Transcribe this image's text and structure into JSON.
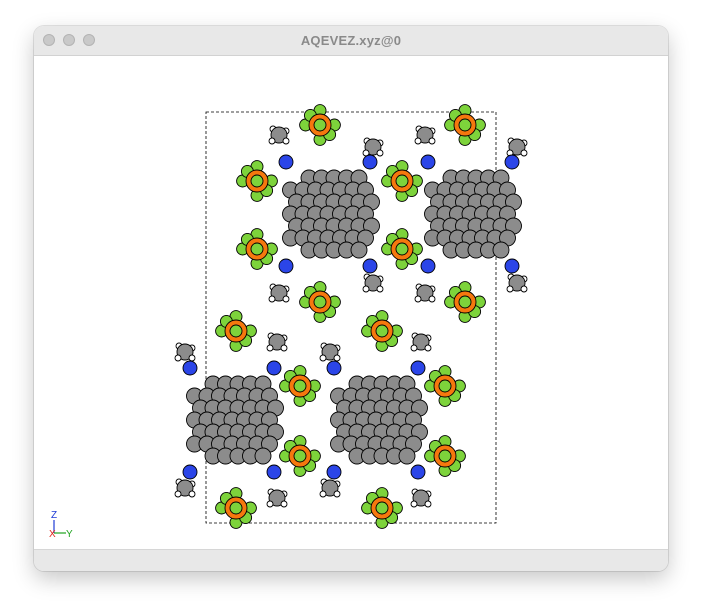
{
  "window": {
    "title": "AQEVEZ.xyz@0"
  },
  "axes": {
    "z_label": "Z",
    "x_label": "X",
    "y_label": "Y",
    "z_color": "#1f3bd6",
    "x_color": "#e0261b",
    "y_color": "#1fa31f"
  },
  "colors": {
    "carbon": "#8c8c8c",
    "nitrogen": "#2b45e8",
    "hydrogen": "#ffffff",
    "fluorine": "#7dd33b",
    "phosphorus": "#f5780e",
    "cell_line": "#000000"
  }
}
